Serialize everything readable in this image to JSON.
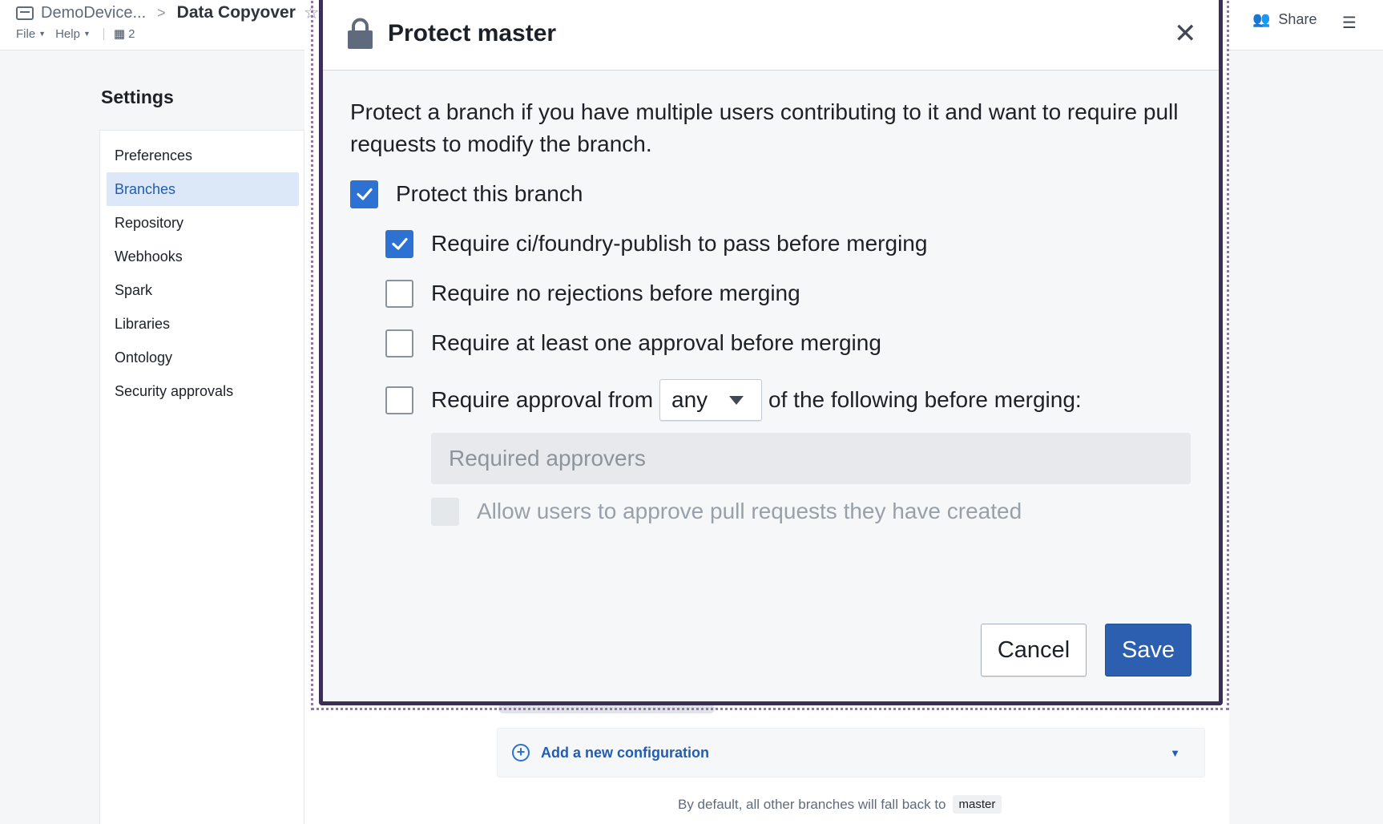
{
  "header": {
    "breadcrumb_parent": "DemoDevice...",
    "breadcrumb_sep": ">",
    "breadcrumb_current": "Data Copyover",
    "file_menu": "File",
    "help_menu": "Help",
    "branch_count": "2",
    "share_label": "Share"
  },
  "settings": {
    "title": "Settings",
    "nav": [
      {
        "label": "Preferences"
      },
      {
        "label": "Branches",
        "active": true
      },
      {
        "label": "Repository"
      },
      {
        "label": "Webhooks"
      },
      {
        "label": "Spark"
      },
      {
        "label": "Libraries"
      },
      {
        "label": "Ontology"
      },
      {
        "label": "Security approvals"
      }
    ]
  },
  "background": {
    "add_config_label": "Add a new configuration",
    "default_note": "By default, all other branches will fall back to",
    "default_branch": "master"
  },
  "dialog": {
    "title": "Protect master",
    "description": "Protect a branch if you have multiple users contributing to it and want to require pull requests to modify the branch.",
    "protect_branch": {
      "label": "Protect this branch",
      "checked": true
    },
    "require_ci": {
      "label": "Require ci/foundry-publish to pass before merging",
      "checked": true
    },
    "require_no_rejections": {
      "label": "Require no rejections before merging",
      "checked": false
    },
    "require_one_approval": {
      "label": "Require at least one approval before merging",
      "checked": false
    },
    "require_approval_from": {
      "label_before": "Require approval from",
      "selected": "any",
      "label_after": "of the following before merging:",
      "checked": false
    },
    "approvers_placeholder": "Required approvers",
    "allow_self_approve": {
      "label": "Allow users to approve pull requests they have created",
      "checked": false,
      "disabled": true
    },
    "cancel_label": "Cancel",
    "save_label": "Save"
  },
  "colors": {
    "accent": "#2d72d2",
    "primary_button": "#2d5fb0",
    "active_nav_bg": "#dce7f8"
  }
}
